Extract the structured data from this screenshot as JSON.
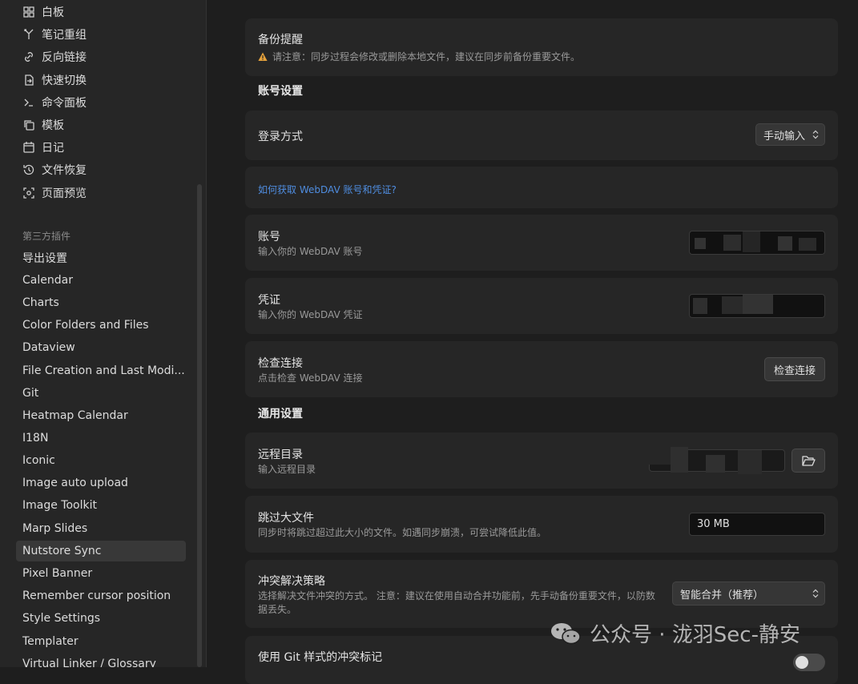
{
  "sidebar": {
    "core_items": [
      {
        "label": "白板",
        "icon": "canvas-grid-icon"
      },
      {
        "label": "笔记重组",
        "icon": "merge-arrow-icon"
      },
      {
        "label": "反向链接",
        "icon": "backlink-icon"
      },
      {
        "label": "快速切换",
        "icon": "switch-file-icon"
      },
      {
        "label": "命令面板",
        "icon": "terminal-icon"
      },
      {
        "label": "模板",
        "icon": "template-copy-icon"
      },
      {
        "label": "日记",
        "icon": "calendar-icon"
      },
      {
        "label": "文件恢复",
        "icon": "history-icon"
      },
      {
        "label": "页面预览",
        "icon": "preview-icon"
      }
    ],
    "third_party_heading": "第三方插件",
    "plugins": [
      "导出设置",
      "Calendar",
      "Charts",
      "Color Folders and Files",
      "Dataview",
      "File Creation and Last Modi...",
      "Git",
      "Heatmap Calendar",
      "I18N",
      "Iconic",
      "Image auto upload",
      "Image Toolkit",
      "Marp Slides",
      "Nutstore Sync",
      "Pixel Banner",
      "Remember cursor position",
      "Style Settings",
      "Templater",
      "Virtual Linker / Glossary"
    ],
    "active_plugin": "Nutstore Sync"
  },
  "main": {
    "backup": {
      "title": "备份提醒",
      "warning": "请注意：同步过程会修改或删除本地文件，建议在同步前备份重要文件。"
    },
    "account_group_title": "账号设置",
    "login": {
      "name": "登录方式",
      "value": "手动输入"
    },
    "webdav_link": "如何获取 WebDAV 账号和凭证?",
    "account": {
      "name": "账号",
      "desc": "输入你的 WebDAV 账号"
    },
    "credential": {
      "name": "凭证",
      "desc": "输入你的 WebDAV 凭证"
    },
    "check": {
      "name": "检查连接",
      "desc": "点击检查 WebDAV 连接",
      "button": "检查连接"
    },
    "general_group_title": "通用设置",
    "remote_dir": {
      "name": "远程目录",
      "desc": "输入远程目录"
    },
    "skip_large": {
      "name": "跳过大文件",
      "desc": "同步时将跳过超过此大小的文件。如遇同步崩溃，可尝试降低此值。",
      "value": "30 MB"
    },
    "conflict": {
      "name": "冲突解决策略",
      "desc_line1": "选择解决文件冲突的方式。 注意：建议在使用自动合并功能前，先手动备份重要文件，以防数",
      "desc_line2": "据丢失。",
      "value": "智能合并（推荐）"
    },
    "git_marker": {
      "name": "使用 Git 样式的冲突标记"
    }
  },
  "watermark": "公众号 · 泷羽Sec-静安",
  "colors": {
    "link": "#4f8de0",
    "warning": "#e6a23c",
    "active_bg": "#383838"
  }
}
